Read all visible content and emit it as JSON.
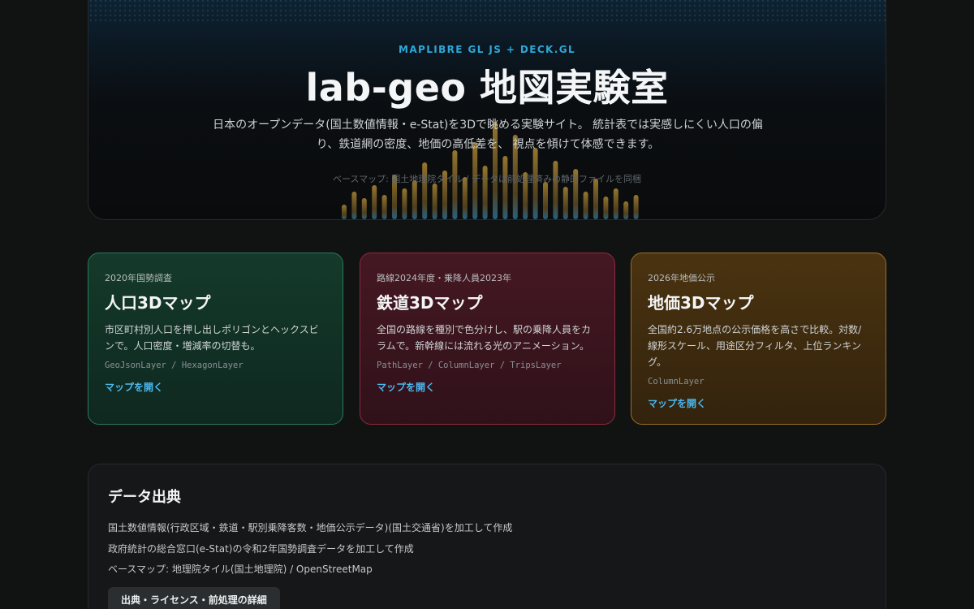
{
  "hero": {
    "eyebrow": "MAPLIBRE GL JS + DECK.GL",
    "title": "lab-geo 地図実験室",
    "description": "日本のオープンデータ(国土数値情報・e-Stat)を3Dで眺める実験サイト。 統計表では実感しにくい人口の偏り、鉄道網の密度、地価の高低差を、 視点を傾けて体感できます。",
    "note": "ベースマップ: 国土地理院タイル / データは前処理済みの静的ファイルを同梱"
  },
  "cards": [
    {
      "kicker": "2020年国勢調査",
      "title": "人口3Dマップ",
      "description": "市区町村別人口を押し出しポリゴンとヘックスビンで。人口密度・増減率の切替も。",
      "layers": "GeoJsonLayer / HexagonLayer",
      "link": "マップを開く"
    },
    {
      "kicker": "路線2024年度・乗降人員2023年",
      "title": "鉄道3Dマップ",
      "description": "全国の路線を種別で色分けし、駅の乗降人員をカラムで。新幹線には流れる光のアニメーション。",
      "layers": "PathLayer / ColumnLayer / TripsLayer",
      "link": "マップを開く"
    },
    {
      "kicker": "2026年地価公示",
      "title": "地価3Dマップ",
      "description": "全国約2.6万地点の公示価格を高さで比較。対数/線形スケール、用途区分フィルタ、上位ランキング。",
      "layers": "ColumnLayer",
      "link": "マップを開く"
    }
  ],
  "credits": {
    "title": "データ出典",
    "lines": [
      "国土数値情報(行政区域・鉄道・駅別乗降客数・地価公示データ)(国土交通省)を加工して作成",
      "政府統計の総合窓口(e-Stat)の令和2年国勢調査データを加工して作成",
      "ベースマップ: 地理院タイル(国土地理院) / OpenStreetMap"
    ],
    "button": "出典・ライセンス・前処理の詳細"
  },
  "colors": {
    "accent": "#4cb8ee",
    "population": "#2a7a5a",
    "railway": "#8e2a3e",
    "landprice": "#9a6f24"
  }
}
